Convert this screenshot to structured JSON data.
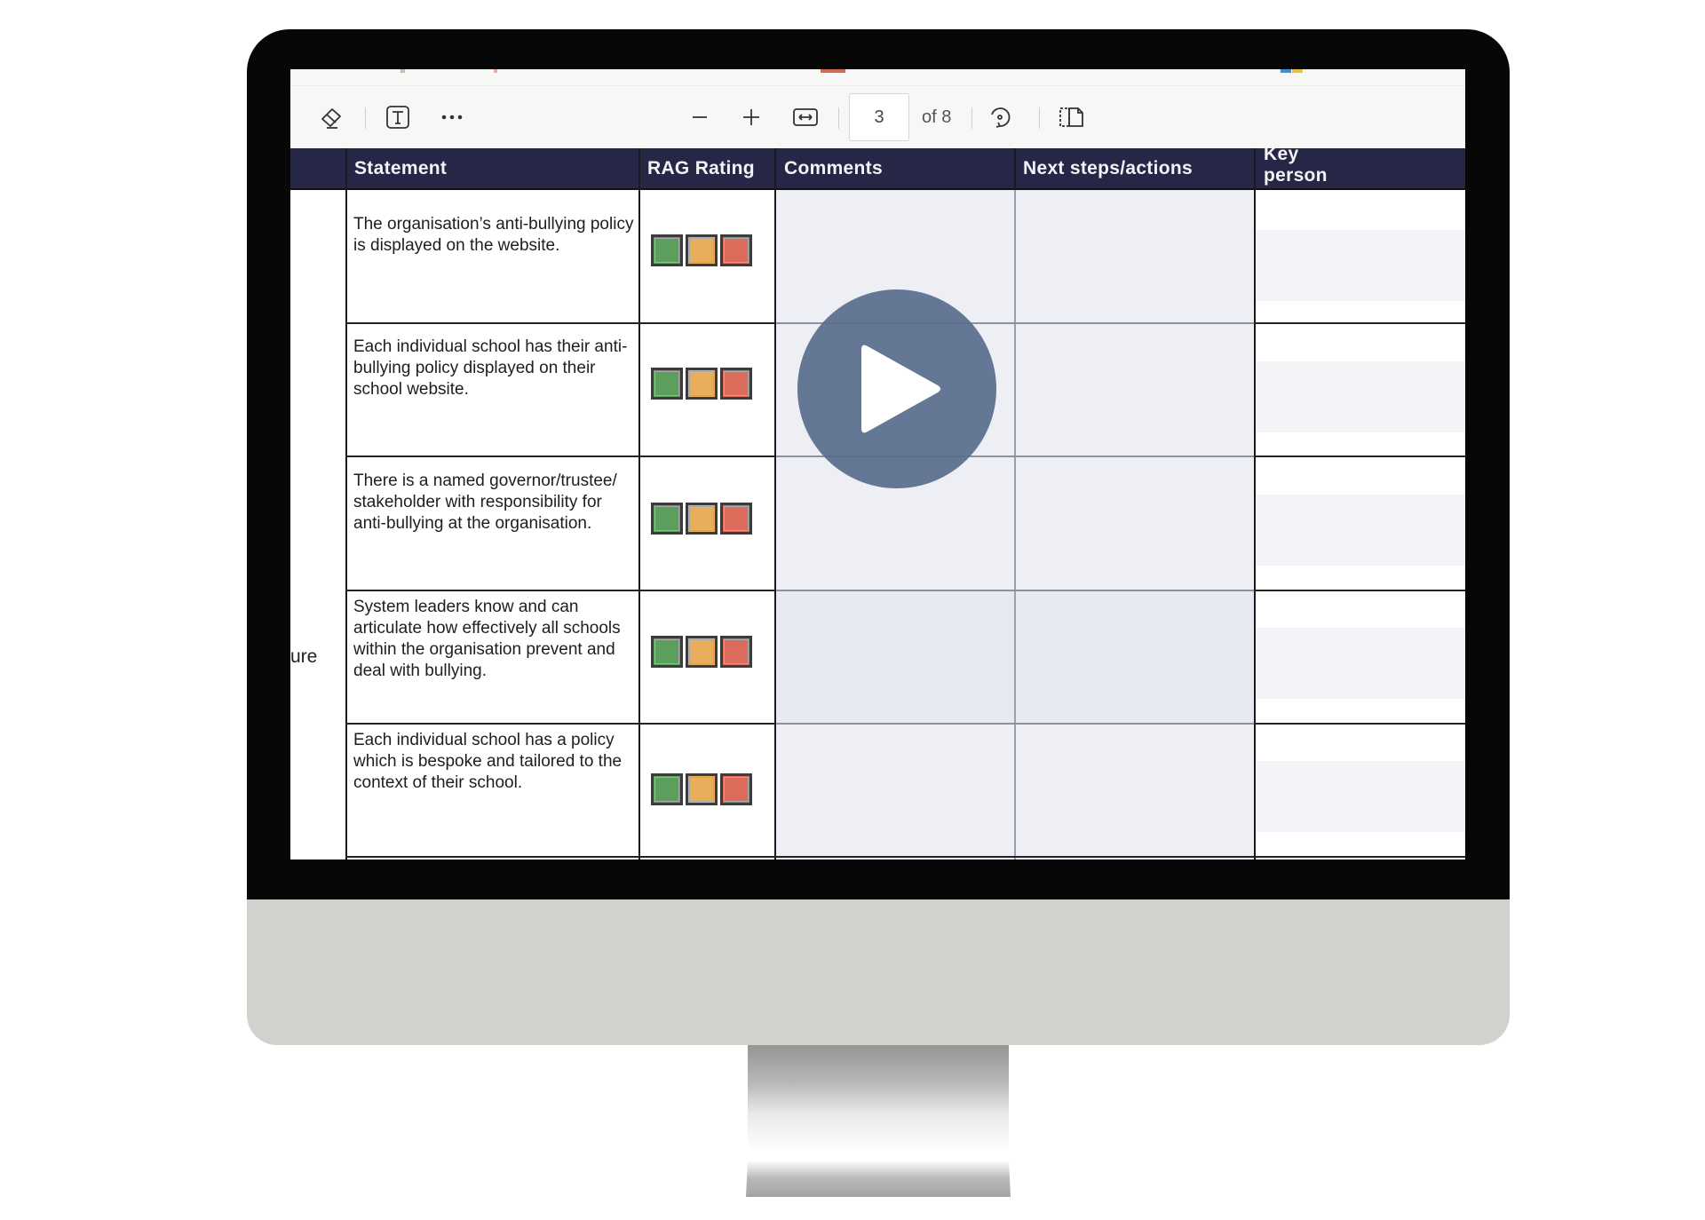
{
  "toolbar": {
    "erase_icon": "eraser-icon",
    "text_icon": "text-box-icon",
    "more_icon": "more-horizontal-icon",
    "zoom_out_icon": "minus-icon",
    "zoom_in_icon": "plus-icon",
    "fit_width_icon": "fit-width-icon",
    "page_current": "3",
    "page_total_label": "of 8",
    "rotate_icon": "rotate-icon",
    "page_view_icon": "page-view-icon"
  },
  "table": {
    "headers": [
      "Statement",
      "RAG Rating",
      "Comments",
      "Next steps/actions",
      "Key person"
    ],
    "key_header_lines": [
      "Key",
      "person"
    ],
    "side_label_fragment": "ure",
    "rows": [
      {
        "statement": "The organisation’s anti-bullying policy is displayed on the website."
      },
      {
        "statement": "Each individual school has their anti-bullying policy displayed on their school website."
      },
      {
        "statement": "There is a named governor/trustee/ stakeholder with responsibility for anti-bullying at the organisation."
      },
      {
        "statement": "System leaders know and can articulate how effectively all schools within the organisation prevent and deal with bullying."
      },
      {
        "statement": "Each individual school has a policy which is bespoke and tailored to the context of their school."
      }
    ],
    "rag_options": [
      "Green",
      "Amber",
      "Red"
    ]
  },
  "colors": {
    "header_bg": "#262746",
    "rag_green": "#5c9e5c",
    "rag_amber": "#e8ae5c",
    "rag_red": "#dc6b5c",
    "play_button": "#5a7090"
  },
  "video": {
    "play_icon": "play-icon"
  }
}
